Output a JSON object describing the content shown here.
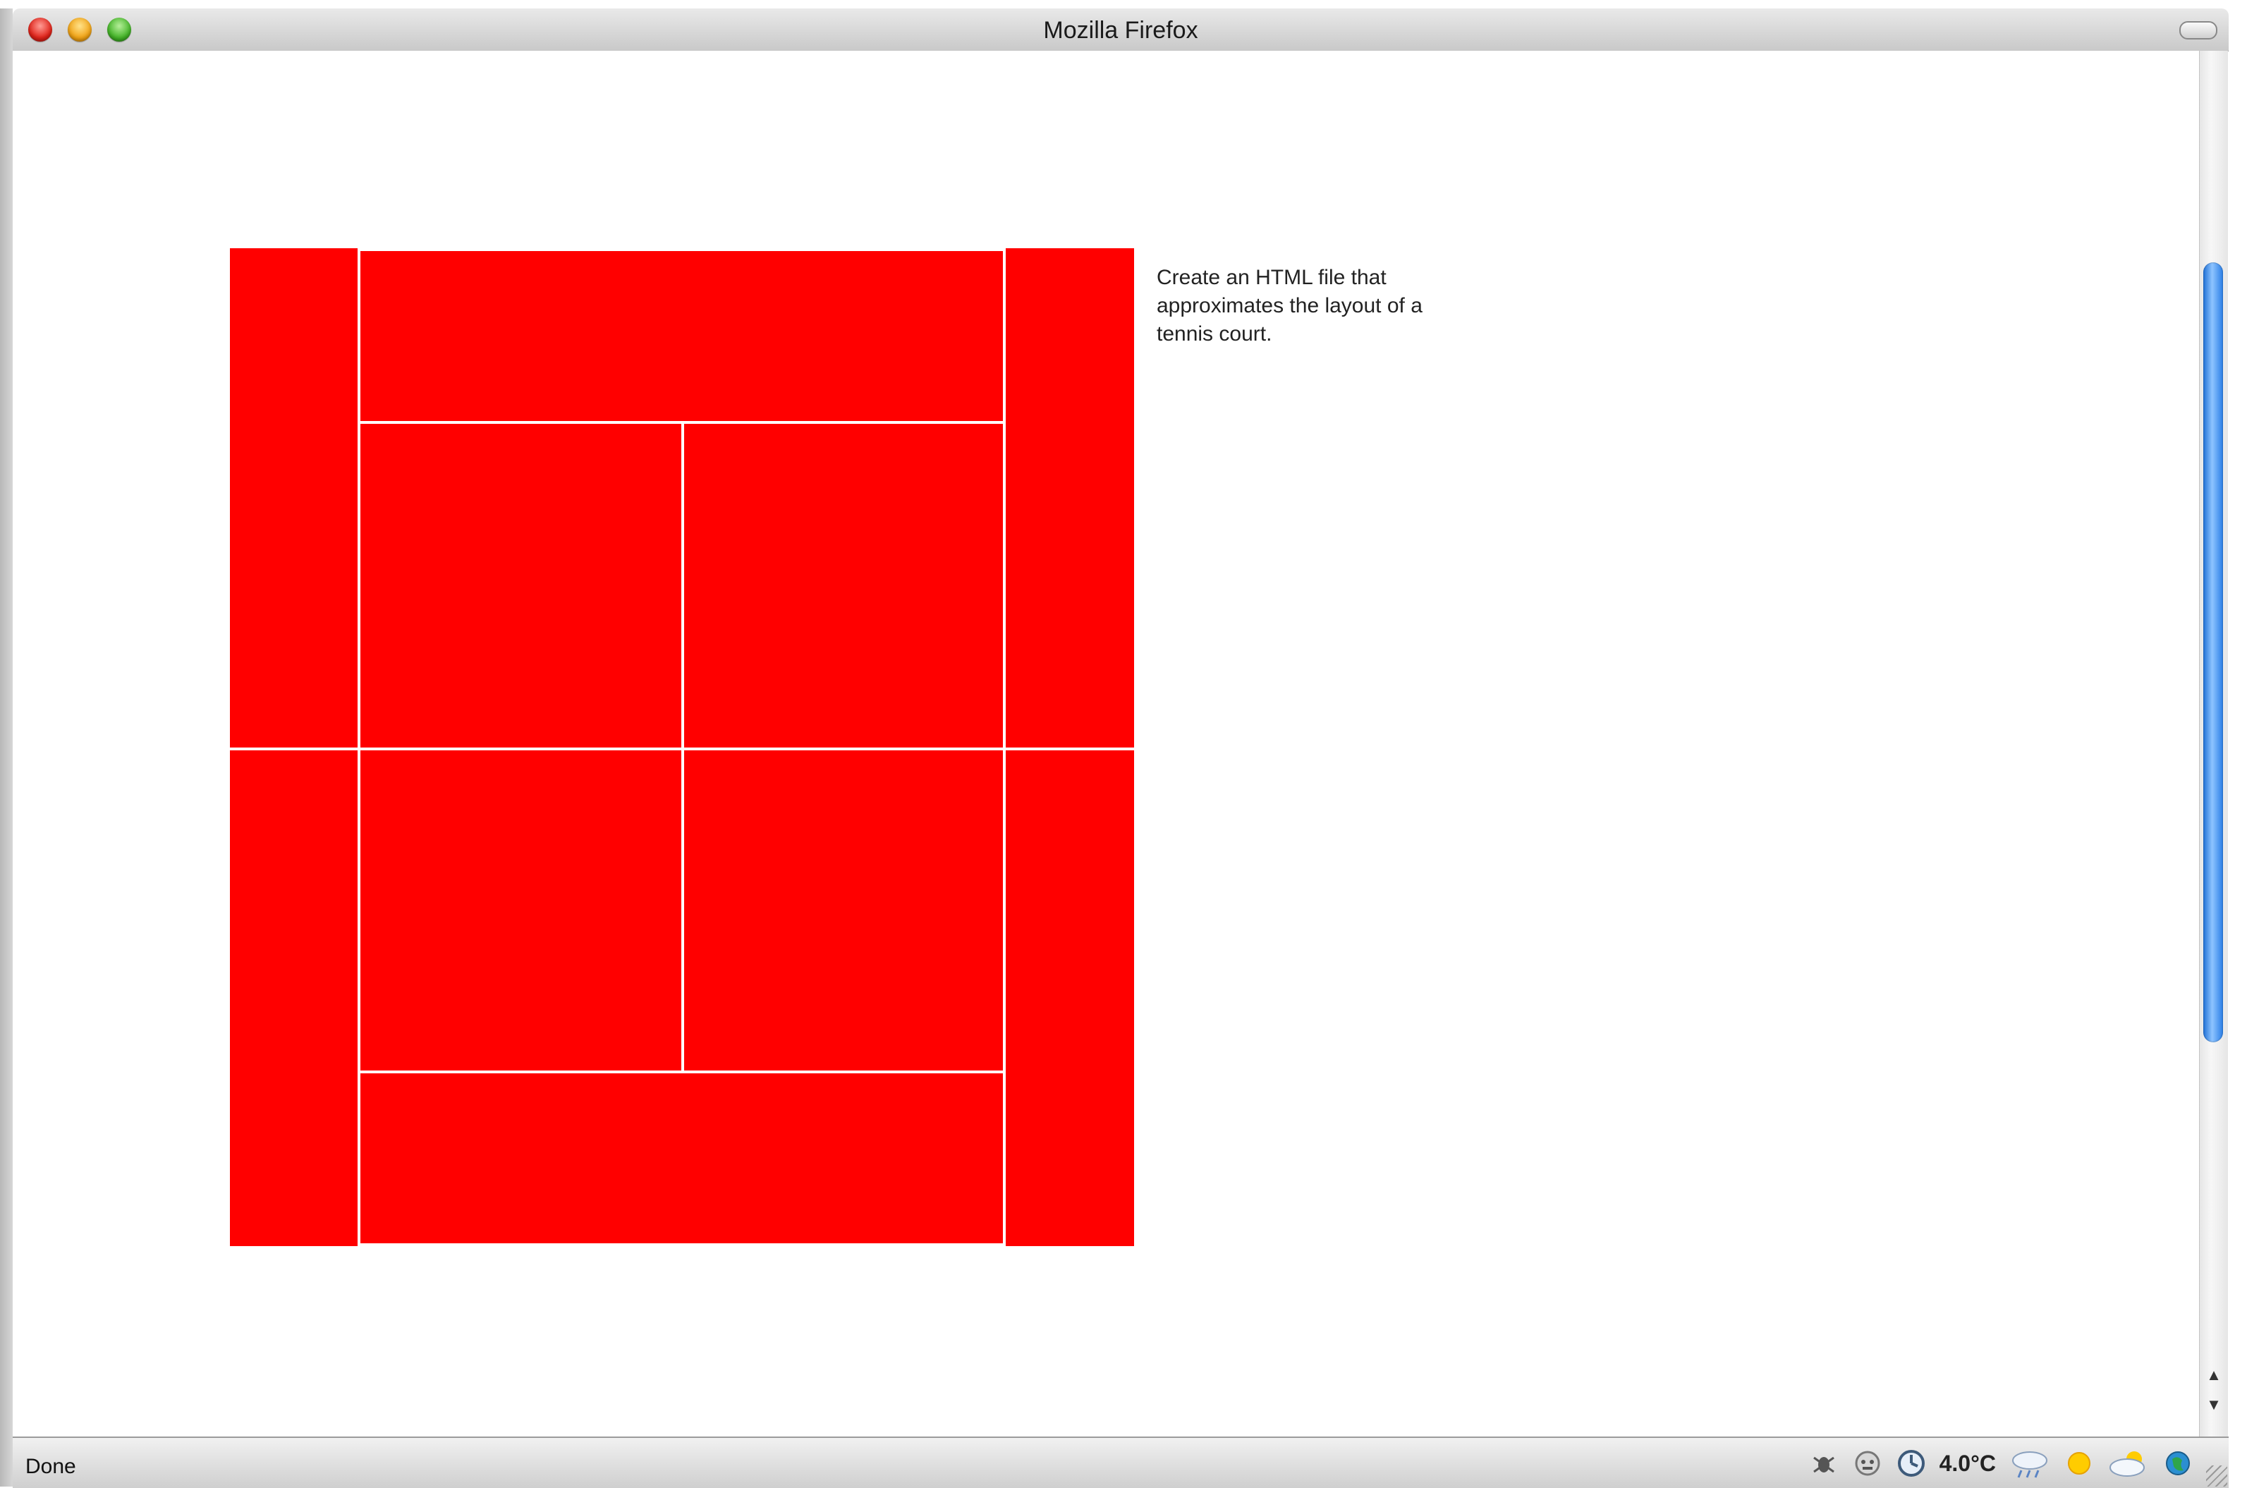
{
  "window": {
    "title": "Mozilla Firefox"
  },
  "page": {
    "description": "Create an HTML file that approximates the layout of a tennis court.",
    "court_color": "#ff0000",
    "line_color": "#ffffff"
  },
  "statusbar": {
    "status": "Done",
    "temperature": "4.0°C",
    "icons": [
      "bug-icon",
      "addon-icon",
      "clock-icon",
      "rain-cloud-icon",
      "sun-icon",
      "partly-cloudy-icon",
      "globe-icon"
    ]
  },
  "scrollbar": {
    "up_arrow": "▲",
    "down_arrow": "▼"
  }
}
